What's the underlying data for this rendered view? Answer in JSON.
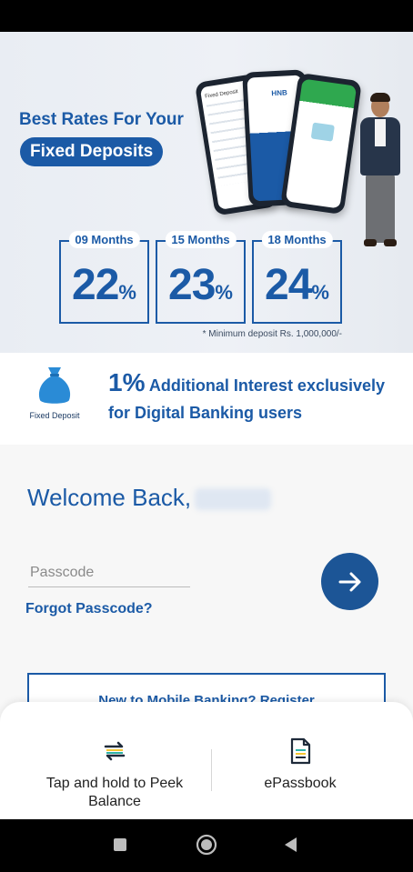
{
  "banner": {
    "title_line_1": "Best Rates For Your",
    "title_line_2": "Fixed Deposits",
    "phone_1_label": "Fixed Deposit",
    "phone_2_brand": "HNB",
    "rates": [
      {
        "term": "09 Months",
        "rate": "22",
        "unit": "%"
      },
      {
        "term": "15 Months",
        "rate": "23",
        "unit": "%"
      },
      {
        "term": "18 Months",
        "rate": "24",
        "unit": "%"
      }
    ],
    "note": "* Minimum deposit Rs. 1,000,000/-",
    "accent_color": "#1b5aa6"
  },
  "promo": {
    "icon_label": "Fixed Deposit",
    "highlight": "1%",
    "line_1": "Additional Interest exclusively",
    "line_2": "for Digital Banking users"
  },
  "login": {
    "welcome": "Welcome Back,",
    "passcode_placeholder": "Passcode",
    "passcode_value": "",
    "forgot_label": "Forgot Passcode?",
    "register_label": "New to Mobile Banking? Register",
    "submit_icon": "arrow-right-icon"
  },
  "bottom_sheet": {
    "peek_balance_label": "Tap and hold to Peek Balance",
    "peek_balance_icon": "swap-arrows-icon",
    "epassbook_label": "ePassbook",
    "epassbook_icon": "document-icon"
  },
  "nav": {
    "recents_icon": "square-icon",
    "home_icon": "circle-icon",
    "back_icon": "triangle-back-icon"
  }
}
